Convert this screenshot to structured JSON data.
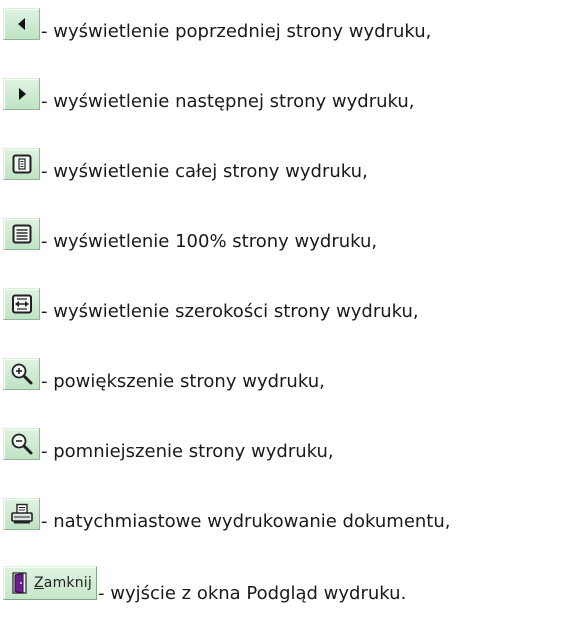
{
  "items": [
    {
      "icon": "previous-page-icon",
      "text": "- wyświetlenie poprzedniej strony wydruku,"
    },
    {
      "icon": "next-page-icon",
      "text": "- wyświetlenie następnej strony wydruku,"
    },
    {
      "icon": "whole-page-icon",
      "text": "- wyświetlenie całej strony wydruku,"
    },
    {
      "icon": "hundred-percent-icon",
      "text": "- wyświetlenie 100% strony wydruku,"
    },
    {
      "icon": "page-width-icon",
      "text": "- wyświetlenie szerokości strony wydruku,"
    },
    {
      "icon": "zoom-in-icon",
      "text": "- powiększenie strony wydruku,"
    },
    {
      "icon": "zoom-out-icon",
      "text": "- pomniejszenie strony wydruku,"
    },
    {
      "icon": "printer-icon",
      "text": "- natychmiastowe wydrukowanie dokumentu,"
    },
    {
      "icon": "door-icon",
      "text": "- wyjście z okna Podgląd wydruku."
    }
  ],
  "close_button": {
    "label": "Zamknij"
  },
  "colors": {
    "button_face": "#c7e6cb",
    "icon_dark": "#111111",
    "door_purple": "#6a1f8f"
  }
}
